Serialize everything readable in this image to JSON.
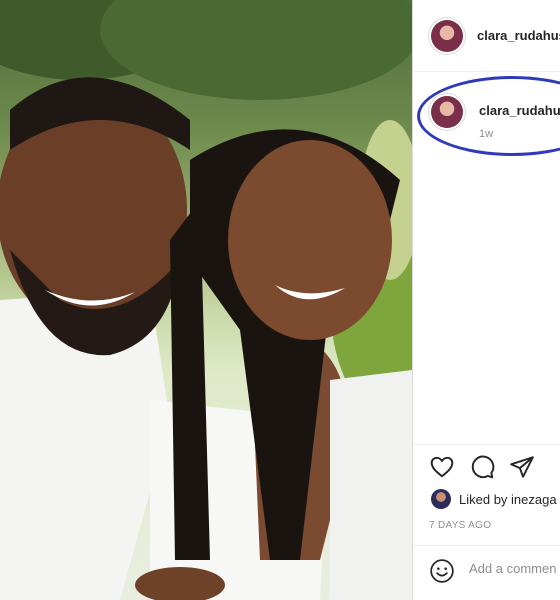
{
  "post": {
    "author": "clara_rudahus",
    "photo_alt": "Photo",
    "caption": {
      "username": "clara_rudahu",
      "time_ago": "1w"
    },
    "liked_by": "Liked by inezaga",
    "date": "7 DAYS AGO",
    "comment_placeholder": "Add a commen"
  },
  "icons": {
    "like": "heart-icon",
    "comment": "comment-bubble-icon",
    "share": "paper-plane-icon",
    "emoji": "smiley-icon"
  },
  "colors": {
    "highlight": "#2f3ab8",
    "text": "#262626",
    "muted": "#8e8e8e",
    "divider": "#dbdbdb"
  }
}
